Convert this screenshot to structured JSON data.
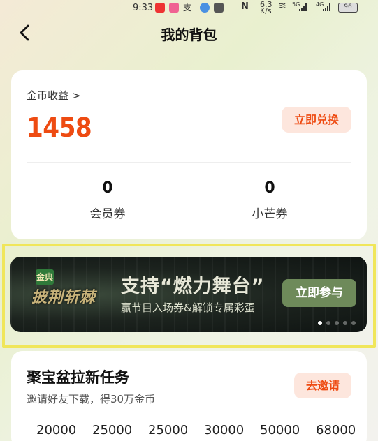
{
  "status_bar": {
    "time": "9:33",
    "net_speed_value": "6.3",
    "net_speed_unit": "K/s",
    "network_5g": "5G",
    "network_4g": "4G",
    "battery": "96"
  },
  "header": {
    "title": "我的背包"
  },
  "coins": {
    "label": "金币收益 >",
    "value": "1458",
    "redeem_label": "立即兑换"
  },
  "stats": [
    {
      "value": "0",
      "label": "会员券"
    },
    {
      "value": "0",
      "label": "小芒券"
    }
  ],
  "banner": {
    "badge": "金典",
    "show_name": "披荆斩棘",
    "headline": "支持“燃力舞台”",
    "subtitle": "赢节目入场券&解锁专属彩蛋",
    "cta": "立即参与",
    "page_count": 5,
    "active_page": 0
  },
  "task": {
    "title": "聚宝盆拉新任务",
    "subtitle": "邀请好友下载，得30万金币",
    "invite_label": "去邀请",
    "rewards": [
      "20000",
      "25000",
      "25000",
      "30000",
      "50000",
      "68000"
    ]
  },
  "colors": {
    "accent": "#ee4b12",
    "accent_bg": "#fde6dd",
    "highlight": "#f0e65a"
  }
}
